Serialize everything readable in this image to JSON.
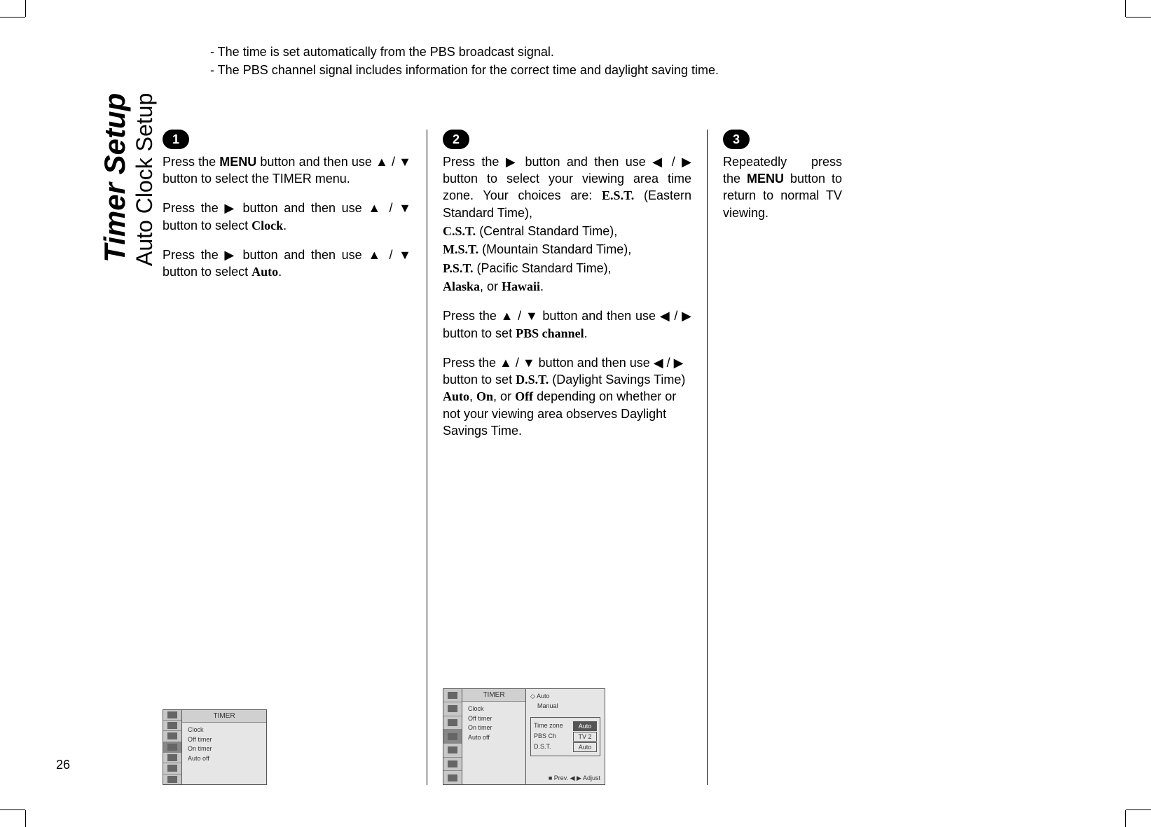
{
  "page_number": "26",
  "title_main": "Timer Setup",
  "title_sub": "Auto Clock Setup",
  "intro": {
    "line1": "-  The time is set automatically from the PBS broadcast signal.",
    "line2": "-  The PBS channel signal includes information for the correct time and daylight saving time."
  },
  "steps": {
    "s1": {
      "badge": "1",
      "p1a": "Press the ",
      "p1_menu": "MENU",
      "p1b": " button and then use ▲ / ▼ button to select the TIMER menu.",
      "p2a": "Press the ▶ button and then use ▲ / ▼ button to select ",
      "p2_clock": "Clock",
      "p2b": ".",
      "p3a": "Press the ▶ button and then use ▲ / ▼ button to select ",
      "p3_auto": "Auto",
      "p3b": "."
    },
    "s2": {
      "badge": "2",
      "p1a": "Press the ▶ button and then use ◀ / ▶ button to select your viewing area time zone. Your choices are: ",
      "p1_est": "E.S.T.",
      "p1b": " (Eastern Standard Time),",
      "p2a": "",
      "p2_cst": "C.S.T.",
      "p2b": " (Central Standard Time),",
      "p3_mst": "M.S.T.",
      "p3b": " (Mountain  Standard Time),",
      "p4_pst": "P.S.T.",
      "p4b": " (Pacific Standard Time),",
      "p5_ak": "Alaska",
      "p5_or": ", or ",
      "p5_hi": "Hawaii",
      "p5b": ".",
      "p6a": "Press the ▲ / ▼  button and then use ◀ / ▶ button to set ",
      "p6_pbs": "PBS channel",
      "p6b": ".",
      "p7a": "Press the ▲ / ▼  button and then use ◀ / ▶ button to set ",
      "p7_dst": "D.S.T.",
      "p7b": " (Daylight Savings Time) ",
      "p7_auto": "Auto",
      "p7c": ", ",
      "p7_on": "On",
      "p7d": ", or ",
      "p7_off": "Off",
      "p7e": " depending on whether or not your viewing area observes Daylight Savings Time."
    },
    "s3": {
      "badge": "3",
      "p1a": "Repeatedly press the ",
      "p1_menu": "MENU",
      "p1b": " button to return to normal TV viewing."
    }
  },
  "osd1": {
    "header": "TIMER",
    "items": [
      "Clock",
      "Off timer",
      "On timer",
      "Auto off"
    ]
  },
  "osd2": {
    "header": "TIMER",
    "items": [
      "Clock",
      "Off timer",
      "On timer",
      "Auto off"
    ],
    "mode_sel": "Auto",
    "mode_other": "Manual",
    "sub": {
      "r1l": "Time zone",
      "r1v": "Auto",
      "r2l": "PBS Ch",
      "r2v": "TV 2",
      "r3l": "D.S.T.",
      "r3v": "Auto"
    },
    "footer": "■ Prev.  ◀ ▶ Adjust"
  }
}
